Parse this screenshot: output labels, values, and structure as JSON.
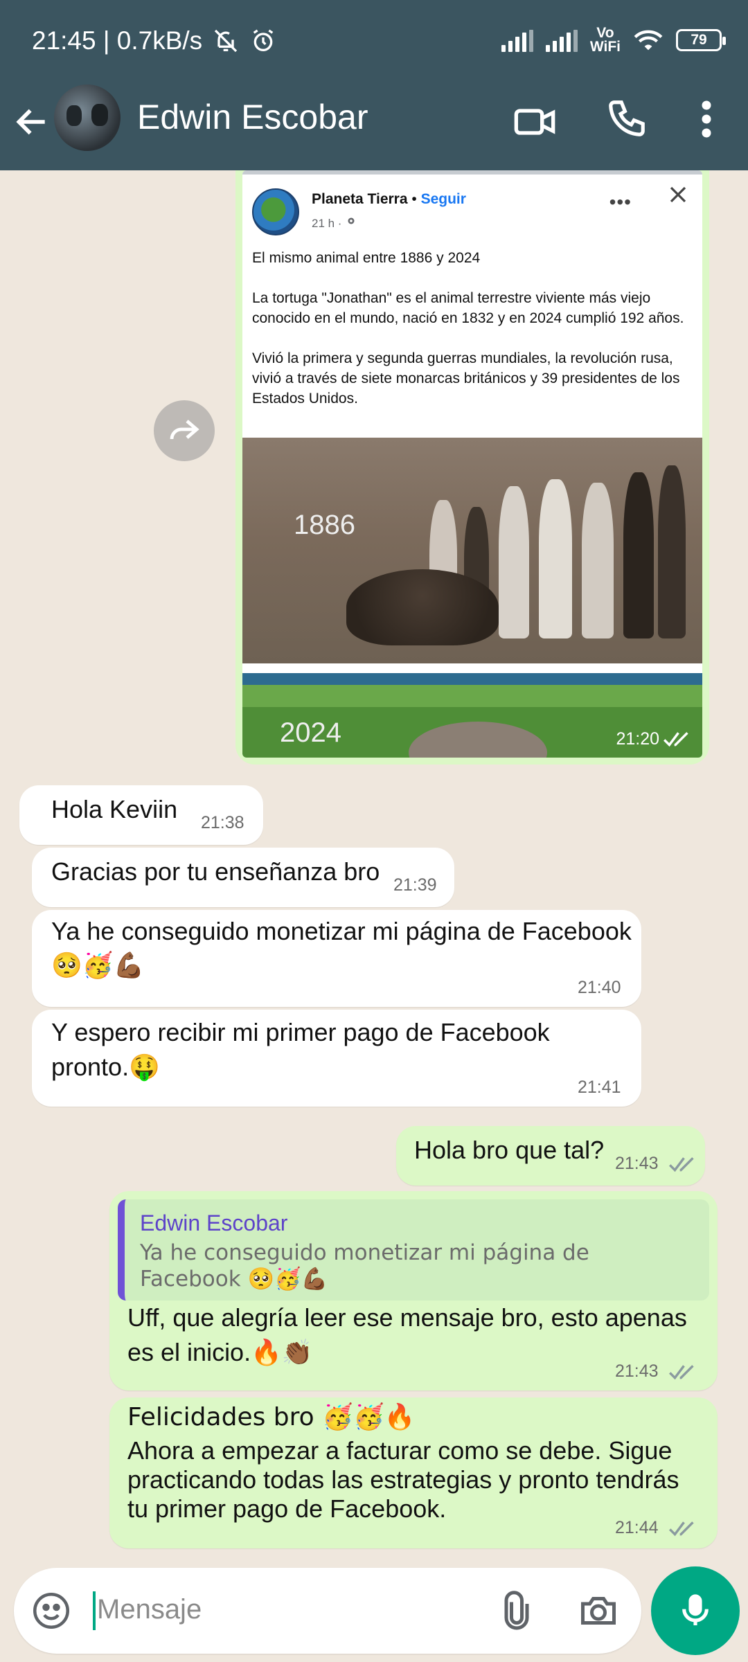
{
  "status_bar": {
    "time_speed": "21:45 | 0.7kB/s",
    "volte": "Vo\nWiFi",
    "battery": "79"
  },
  "header": {
    "contact_name": "Edwin Escobar"
  },
  "shared_post": {
    "page_name": "Planeta Tierra",
    "separator": "•",
    "follow_label": "Seguir",
    "meta": "21 h ·",
    "text_1": "El mismo animal entre 1886 y 2024",
    "text_2": "La tortuga \"Jonathan\" es el animal terrestre viviente más viejo conocido en el mundo, nació en 1832 y en 2024 cumplió 192 años.",
    "text_3": "Vivió la primera y segunda guerras mundiales, la revolución rusa, vivió a través de siete monarcas británicos y 39 presidentes de los Estados Unidos.",
    "year_old": "1886",
    "year_new": "2024",
    "time": "21:20"
  },
  "messages": [
    {
      "text": "Hola Keviin",
      "time": "21:38"
    },
    {
      "text": "Gracias por tu enseñanza bro",
      "time": "21:39"
    },
    {
      "text": "Ya he conseguido monetizar mi página de Facebook",
      "emoji": "🥺🥳💪🏾",
      "time": "21:40"
    },
    {
      "text": "Y espero recibir mi primer pago de Facebook",
      "text2": "pronto.🤑",
      "time": "21:41"
    },
    {
      "text": "Hola bro que tal?",
      "time": "21:43"
    },
    {
      "quote_name": "Edwin Escobar",
      "quote_text": "Ya he conseguido monetizar mi página de Facebook 🥺🥳💪🏾",
      "text": "Uff, que alegría leer ese mensaje bro, esto apenas",
      "text2": "es el inicio.🔥👏🏾",
      "time": "21:43"
    },
    {
      "text": "Felicidades bro 🥳🥳🔥",
      "text2": "Ahora a empezar a facturar como se debe. Sigue",
      "text3": "practicando todas las estrategias y pronto tendrás",
      "text4": "tu primer pago de Facebook.",
      "time": "21:44"
    }
  ],
  "composer": {
    "placeholder": "Mensaje"
  },
  "colors": {
    "header": "#3b5560",
    "accent": "#00a884",
    "outgoing": "#dcf8c6",
    "incoming": "#ffffff"
  }
}
